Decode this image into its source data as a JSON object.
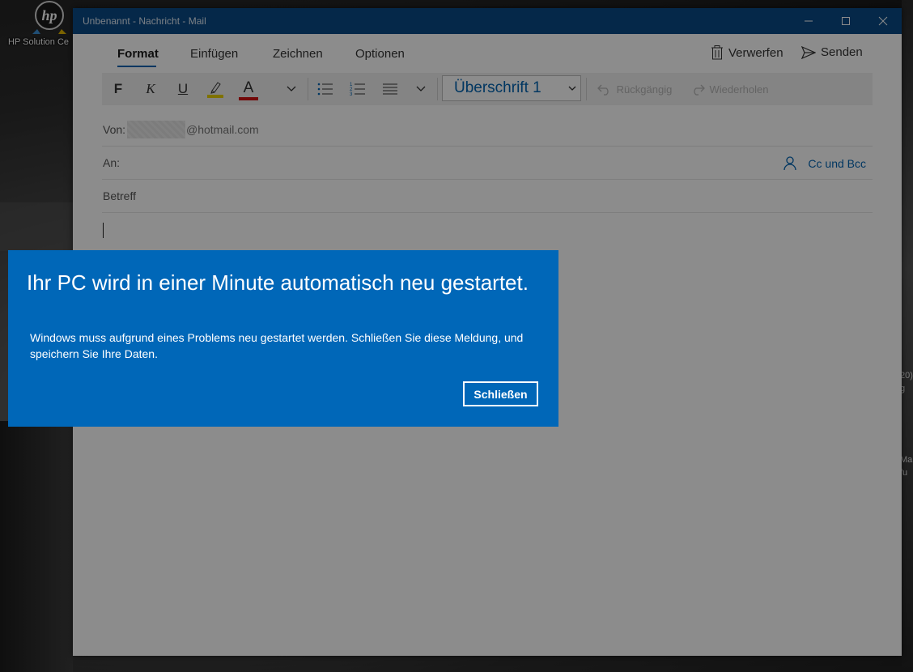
{
  "desktop": {
    "hp_label": "HP Solution Ce",
    "right_fragments": [
      "20)",
      "g",
      "Ma",
      "fu"
    ]
  },
  "window": {
    "title": "Unbenannt - Nachricht - Mail",
    "minimize_icon": "minimize-icon",
    "maximize_icon": "maximize-icon",
    "close_icon": "close-icon"
  },
  "ribbon": {
    "tabs": [
      {
        "label": "Format",
        "active": true
      },
      {
        "label": "Einfügen",
        "active": false
      },
      {
        "label": "Zeichnen",
        "active": false
      },
      {
        "label": "Optionen",
        "active": false
      }
    ],
    "discard_label": "Verwerfen",
    "send_label": "Senden"
  },
  "toolbar": {
    "bold": "F",
    "italic": "K",
    "underline": "U",
    "font_color_letter": "A",
    "highlight_color": "#e8d000",
    "font_color": "#d01010",
    "style_value": "Überschrift 1",
    "undo_label": "Rückgängig",
    "redo_label": "Wiederholen"
  },
  "compose": {
    "from_label": "Von:",
    "from_domain": "@hotmail.com",
    "to_label": "An:",
    "ccbcc_label": "Cc und Bcc",
    "subject_label": "Betreff"
  },
  "dialog": {
    "title": "Ihr PC wird in einer Minute automatisch neu gestartet.",
    "body": "Windows muss aufgrund eines Problems neu gestartet werden. Schließen Sie diese Meldung, und speichern Sie Ihre Daten.",
    "close_label": "Schließen",
    "accent": "#0067b8"
  }
}
